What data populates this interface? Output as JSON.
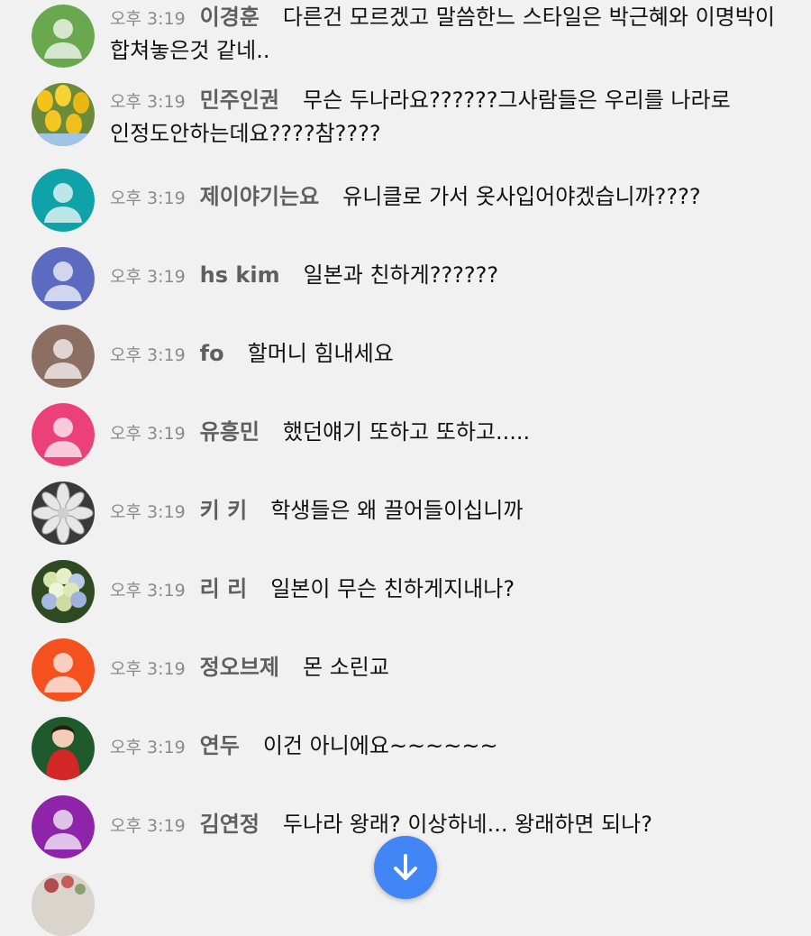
{
  "messages": [
    {
      "time": "오후 3:19",
      "author": "이경훈",
      "text": "다른건 모르겠고 말씀한느 스타일은 박근혜와 이명박이 합쳐놓은것 같네..",
      "avatar": {
        "type": "default",
        "color": "#6aa84f"
      }
    },
    {
      "time": "오후 3:19",
      "author": "민주인권",
      "text": "무슨 두나라요??????그사람들은 우리를 나라로 인정도안하는데요????참????",
      "avatar": {
        "type": "photo",
        "icon": "yellow-tulips-photo"
      }
    },
    {
      "time": "오후 3:19",
      "author": "제이야기는요",
      "text": "유니클로 가서 옷사입어야겠습니까????",
      "avatar": {
        "type": "default",
        "color": "#0fa2a8"
      }
    },
    {
      "time": "오후 3:19",
      "author": "hs kim",
      "text": "일본과 친하게??????",
      "avatar": {
        "type": "default",
        "color": "#5c6bc0"
      }
    },
    {
      "time": "오후 3:19",
      "author": "fo",
      "text": "할머니 힘내세요",
      "avatar": {
        "type": "default",
        "color": "#8d6e63"
      }
    },
    {
      "time": "오후 3:19",
      "author": "유흥민",
      "text": "했던얘기 또하고 또하고.....",
      "avatar": {
        "type": "default",
        "color": "#ec407a"
      }
    },
    {
      "time": "오후 3:19",
      "author": "키 키",
      "text": "학생들은 왜 끌어들이십니까",
      "avatar": {
        "type": "photo",
        "icon": "white-flower-photo"
      }
    },
    {
      "time": "오후 3:19",
      "author": "리 리",
      "text": "일본이 무슨 친하게지내나?",
      "avatar": {
        "type": "photo",
        "icon": "hydrangea-photo"
      }
    },
    {
      "time": "오후 3:19",
      "author": "정오브제",
      "text": "몬 소린교",
      "avatar": {
        "type": "default",
        "color": "#f4511e"
      }
    },
    {
      "time": "오후 3:19",
      "author": "연두",
      "text": "이건 아니에요~~~~~~",
      "avatar": {
        "type": "photo",
        "icon": "woman-red-dress-photo"
      }
    },
    {
      "time": "오후 3:19",
      "author": "김연정",
      "text": "두나라 왕래? 이상하네... 왕래하면 되나?",
      "avatar": {
        "type": "default",
        "color": "#8e24aa"
      }
    }
  ],
  "scroll_button": {
    "icon": "arrow-down-icon",
    "color": "#4285f4"
  }
}
